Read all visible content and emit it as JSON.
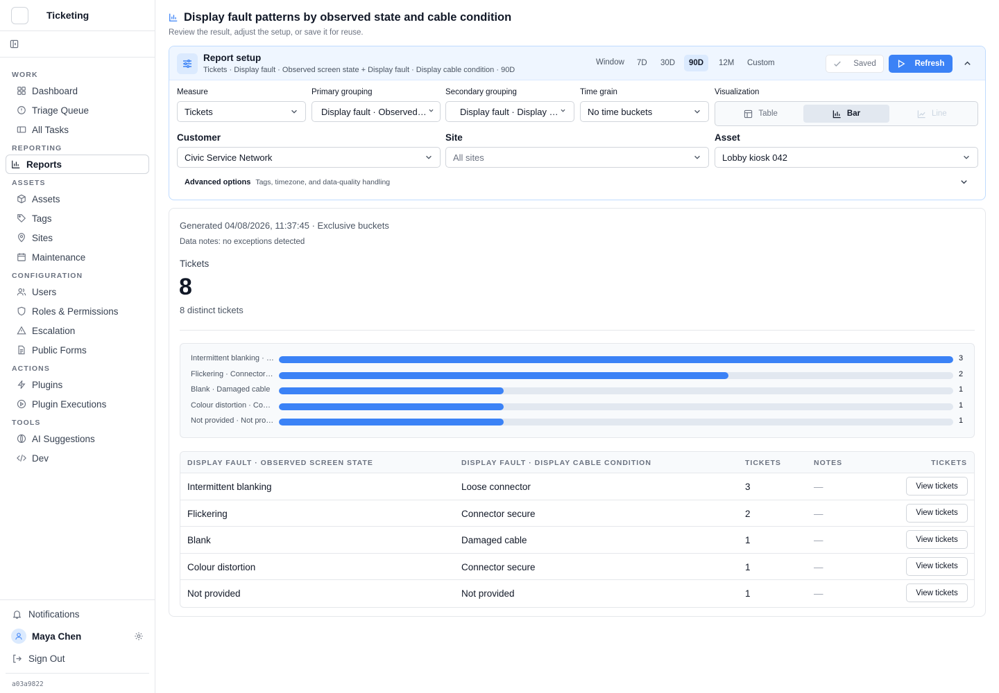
{
  "app": {
    "name": "Ticketing",
    "build": "a03a9822"
  },
  "sidebar": {
    "sections": [
      {
        "title": "WORK",
        "items": [
          {
            "label": "Dashboard",
            "icon": "dashboard-icon"
          },
          {
            "label": "Triage Queue",
            "icon": "alert-circle-icon"
          },
          {
            "label": "All Tasks",
            "icon": "ticket-icon"
          }
        ]
      },
      {
        "title": "REPORTING",
        "items": [
          {
            "label": "Reports",
            "icon": "bar-chart-icon",
            "active": true
          }
        ]
      },
      {
        "title": "ASSETS",
        "items": [
          {
            "label": "Assets",
            "icon": "box-icon"
          },
          {
            "label": "Tags",
            "icon": "tag-icon"
          },
          {
            "label": "Sites",
            "icon": "map-pin-icon"
          },
          {
            "label": "Maintenance",
            "icon": "calendar-icon"
          }
        ]
      },
      {
        "title": "CONFIGURATION",
        "items": [
          {
            "label": "Users",
            "icon": "users-icon"
          },
          {
            "label": "Roles & Permissions",
            "icon": "shield-icon"
          },
          {
            "label": "Escalation",
            "icon": "warning-triangle-icon"
          },
          {
            "label": "Public Forms",
            "icon": "document-icon"
          }
        ]
      },
      {
        "title": "ACTIONS",
        "items": [
          {
            "label": "Plugins",
            "icon": "lightning-icon"
          },
          {
            "label": "Plugin Executions",
            "icon": "play-circle-icon"
          }
        ]
      },
      {
        "title": "TOOLS",
        "items": [
          {
            "label": "AI Suggestions",
            "icon": "ai-icon"
          },
          {
            "label": "Dev",
            "icon": "code-icon"
          }
        ]
      }
    ],
    "notifications": "Notifications",
    "user": "Maya Chen",
    "signout": "Sign Out"
  },
  "page": {
    "title": "Display fault patterns by observed state and cable condition",
    "subtitle": "Review the result, adjust the setup, or save it for reuse."
  },
  "setup": {
    "title": "Report setup",
    "summary": "Tickets · Display fault · Observed screen state + Display fault · Display cable condition · 90D",
    "window_label": "Window",
    "windows": [
      "7D",
      "30D",
      "90D",
      "12M",
      "Custom"
    ],
    "active_window": "90D",
    "saved_label": "Saved",
    "refresh_label": "Refresh",
    "measure": {
      "label": "Measure",
      "value": "Tickets"
    },
    "primary": {
      "label": "Primary grouping",
      "value": "Display fault · Observed screen state"
    },
    "secondary": {
      "label": "Secondary grouping",
      "value": "Display fault · Display cable condition"
    },
    "time_grain": {
      "label": "Time grain",
      "value": "No time buckets"
    },
    "visualization": {
      "label": "Visualization",
      "options": [
        "Table",
        "Bar",
        "Line"
      ],
      "active": "Bar"
    },
    "customer": {
      "label": "Customer",
      "value": "Civic Service Network"
    },
    "site": {
      "label": "Site",
      "value": "All sites"
    },
    "asset": {
      "label": "Asset",
      "value": "Lobby kiosk 042"
    },
    "advanced_title": "Advanced options",
    "advanced_sub": "Tags, timezone, and data-quality handling"
  },
  "result": {
    "generated": "Generated 04/08/2026, 11:37:45 · Exclusive buckets",
    "notes": "Data notes: no exceptions detected",
    "kpi_label": "Tickets",
    "kpi_value": "8",
    "kpi_sub": "8 distinct tickets"
  },
  "chart_data": {
    "type": "bar",
    "orientation": "horizontal",
    "categories": [
      "Intermittent blanking · Loose connector",
      "Flickering · Connector secure",
      "Blank · Damaged cable",
      "Colour distortion · Connector secure",
      "Not provided · Not provided"
    ],
    "values": [
      3,
      2,
      1,
      1,
      1
    ],
    "xlim": [
      0,
      3
    ],
    "color": "#3b82f6",
    "track_color": "#e2e8f0"
  },
  "table": {
    "headers": [
      "DISPLAY FAULT · OBSERVED SCREEN STATE",
      "DISPLAY FAULT · DISPLAY CABLE CONDITION",
      "TICKETS",
      "NOTES",
      "TICKETS"
    ],
    "action_label": "View tickets",
    "rows": [
      [
        "Intermittent blanking",
        "Loose connector",
        "3",
        "—"
      ],
      [
        "Flickering",
        "Connector secure",
        "2",
        "—"
      ],
      [
        "Blank",
        "Damaged cable",
        "1",
        "—"
      ],
      [
        "Colour distortion",
        "Connector secure",
        "1",
        "—"
      ],
      [
        "Not provided",
        "Not provided",
        "1",
        "—"
      ]
    ]
  }
}
